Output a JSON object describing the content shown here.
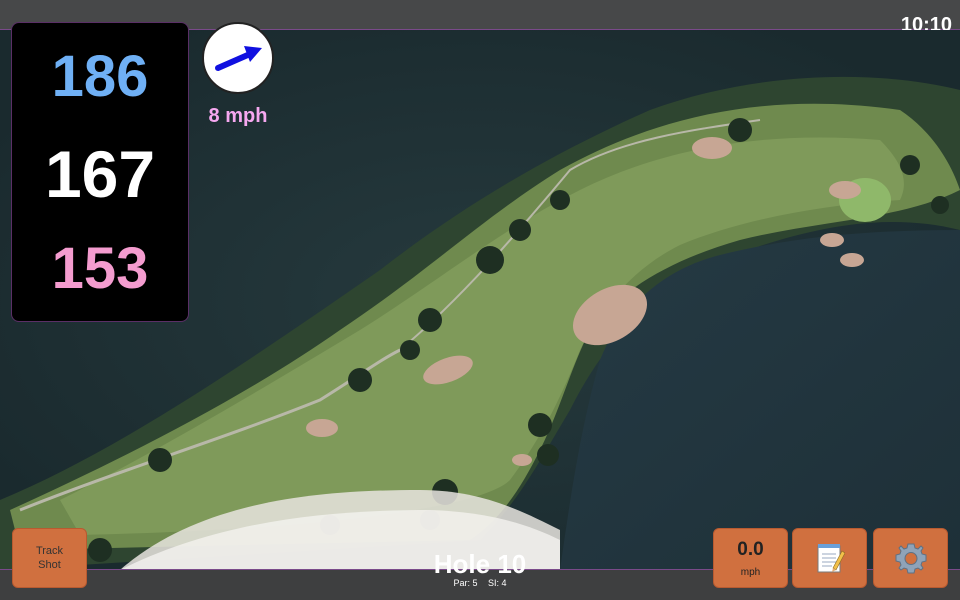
{
  "status": {
    "time": "10:10"
  },
  "distances": {
    "back": "186",
    "middle": "167",
    "front": "153"
  },
  "wind": {
    "speed_label": "8 mph",
    "direction_icon": "wind-arrow-icon"
  },
  "hole": {
    "title": "Hole 10",
    "par_label": "Par: 5",
    "si_label": "SI: 4"
  },
  "buttons": {
    "track_shot": {
      "line1": "Track",
      "line2": "Shot"
    },
    "speed": {
      "value": "0.0",
      "unit": "mph"
    },
    "notes": {
      "icon": "notepad-icon"
    },
    "settings": {
      "icon": "gear-icon"
    }
  },
  "colors": {
    "back_distance": "#6fb0f5",
    "middle_distance": "#ffffff",
    "front_distance": "#f49ccf",
    "wind_label": "#f6a8f0",
    "button_accent": "#d0703f"
  }
}
